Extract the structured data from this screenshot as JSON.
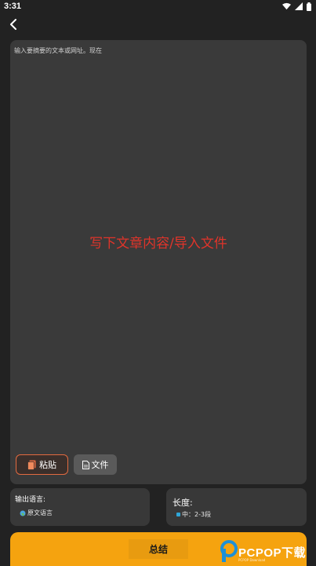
{
  "status_bar": {
    "time": "3:31"
  },
  "editor": {
    "placeholder": "输入要摘要的文本或网址。现在",
    "center_hint": "写下文章内容/导入文件",
    "paste_label": "粘贴",
    "file_label": "文件"
  },
  "output_language": {
    "title": "输出语言:",
    "value": "原文语言"
  },
  "length": {
    "title": "长度:",
    "value": "中：2-3段"
  },
  "summary_button": {
    "label": "总结"
  },
  "watermark": {
    "brand": "PCPOP下载",
    "sub": "PCPOP Download"
  },
  "colors": {
    "accent": "#f5a30f",
    "hint_red": "#e0342a",
    "paste_border": "#e26a40"
  },
  "icons": [
    "back-icon",
    "wifi-icon",
    "signal-icon",
    "battery-icon",
    "clipboard-icon",
    "file-icon"
  ]
}
